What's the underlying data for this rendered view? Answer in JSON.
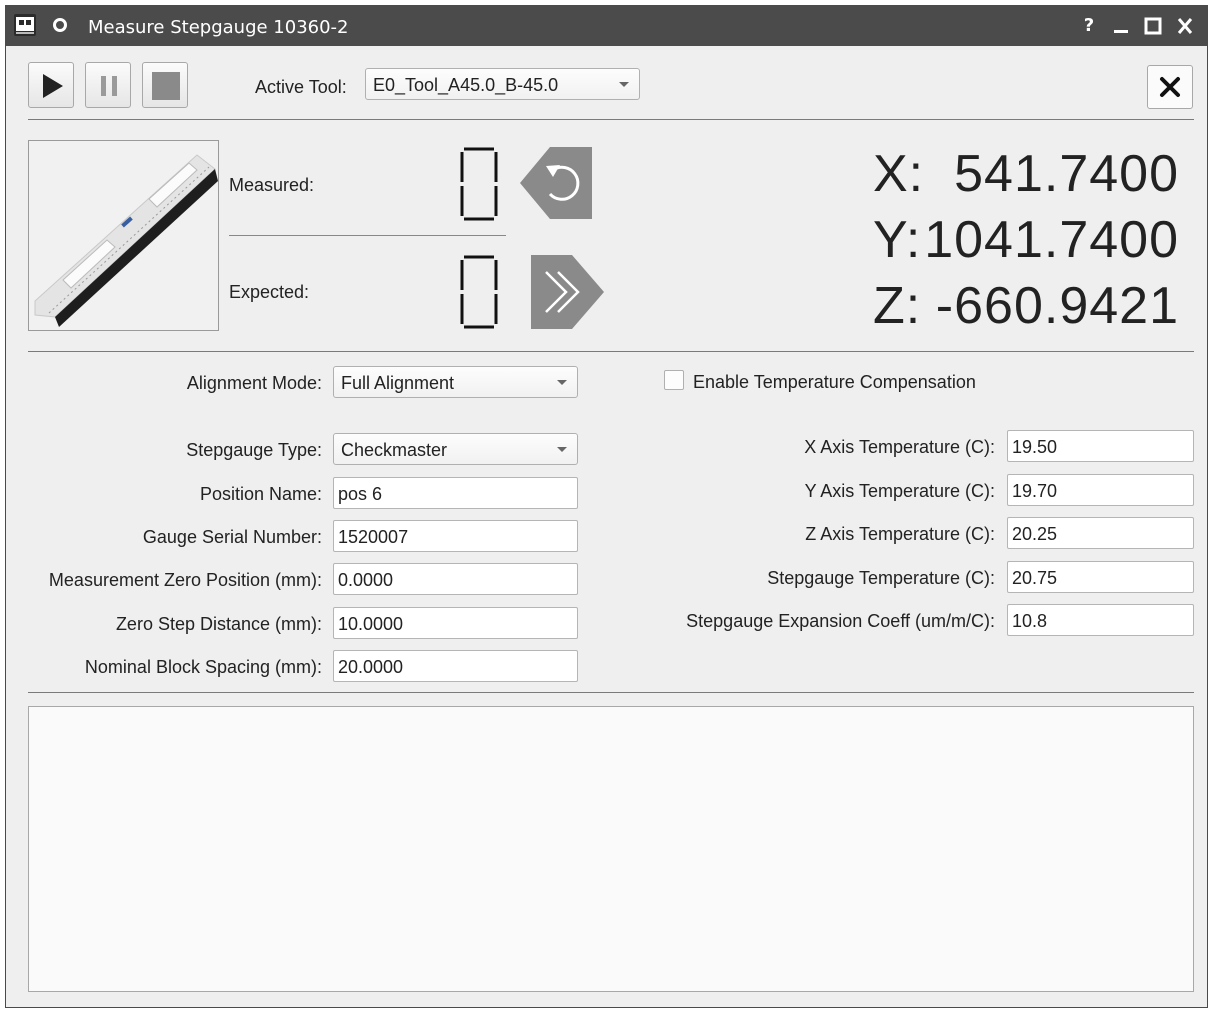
{
  "window": {
    "title": "Measure Stepgauge 10360-2",
    "buttons": [
      "?",
      "_",
      "□",
      "✕"
    ]
  },
  "toolbar": {
    "play_icon": "play-icon",
    "pause_icon": "pause-icon",
    "stop_icon": "stop-icon",
    "active_tool_label": "Active Tool:",
    "active_tool_value": "E0_Tool_A45.0_B-45.0",
    "close_icon": "close-icon"
  },
  "status": {
    "measured_label": "Measured:",
    "measured_value": "0",
    "expected_label": "Expected:",
    "expected_value": "0",
    "reset_icon": "undo-arrow-icon",
    "next_icon": "fast-forward-icon",
    "image_icon": "stepgauge-image"
  },
  "position": {
    "x_label": "X:",
    "x_value": "541.7400",
    "y_label": "Y:",
    "y_value": "1041.7400",
    "z_label": "Z:",
    "z_value": "-660.9421"
  },
  "form": {
    "alignment_mode": {
      "label": "Alignment Mode:",
      "value": "Full Alignment"
    },
    "enable_temp_comp": {
      "label": "Enable Temperature Compensation",
      "checked": false
    },
    "stepgauge_type": {
      "label": "Stepgauge Type:",
      "value": "Checkmaster"
    },
    "position_name": {
      "label": "Position Name:",
      "value": "pos 6"
    },
    "gauge_serial": {
      "label": "Gauge Serial Number:",
      "value": "1520007"
    },
    "zero_position": {
      "label": "Measurement Zero Position (mm):",
      "value": "0.0000"
    },
    "zero_step": {
      "label": "Zero Step Distance (mm):",
      "value": "10.0000"
    },
    "block_spacing": {
      "label": "Nominal Block Spacing (mm):",
      "value": "20.0000"
    },
    "x_temp": {
      "label": "X Axis Temperature (C):",
      "value": "19.50"
    },
    "y_temp": {
      "label": "Y Axis Temperature (C):",
      "value": "19.70"
    },
    "z_temp": {
      "label": "Z Axis Temperature (C):",
      "value": "20.25"
    },
    "gauge_temp": {
      "label": "Stepgauge Temperature (C):",
      "value": "20.75"
    },
    "expansion_coeff": {
      "label": "Stepgauge Expansion Coeff (um/m/C):",
      "value": "10.8"
    }
  },
  "log": {
    "text": ""
  }
}
